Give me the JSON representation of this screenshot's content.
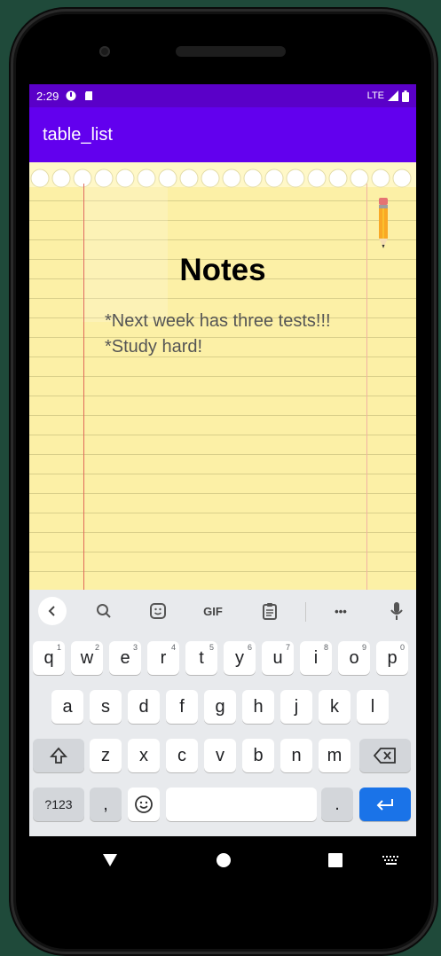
{
  "status_bar": {
    "time": "2:29",
    "network": "LTE"
  },
  "app_bar": {
    "title": "table_list"
  },
  "content": {
    "title": "Notes",
    "lines": [
      "*Next week has three tests!!!",
      "*Study hard!"
    ]
  },
  "keyboard": {
    "toolbar": {
      "gif_label": "GIF",
      "more_label": "•••"
    },
    "row1": [
      {
        "label": "q",
        "sup": "1"
      },
      {
        "label": "w",
        "sup": "2"
      },
      {
        "label": "e",
        "sup": "3"
      },
      {
        "label": "r",
        "sup": "4"
      },
      {
        "label": "t",
        "sup": "5"
      },
      {
        "label": "y",
        "sup": "6"
      },
      {
        "label": "u",
        "sup": "7"
      },
      {
        "label": "i",
        "sup": "8"
      },
      {
        "label": "o",
        "sup": "9"
      },
      {
        "label": "p",
        "sup": "0"
      }
    ],
    "row2": [
      "a",
      "s",
      "d",
      "f",
      "g",
      "h",
      "j",
      "k",
      "l"
    ],
    "row3": [
      "z",
      "x",
      "c",
      "v",
      "b",
      "n",
      "m"
    ],
    "row4": {
      "symbols_label": "?123",
      "comma_label": ",",
      "period_label": "."
    }
  },
  "colors": {
    "status_bar": "#5a00c8",
    "app_bar": "#6200ee",
    "enter_key": "#1a73e8",
    "paper": "#fcf0a6"
  }
}
